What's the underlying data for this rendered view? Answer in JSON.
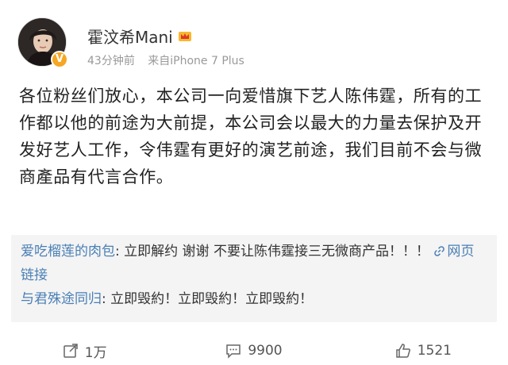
{
  "user": {
    "name": "霍汶希Mani",
    "badge_icon": "crown-icon",
    "time_ago": "43分钟前",
    "source": "来自iPhone 7 Plus",
    "verified_badge": "V"
  },
  "post": {
    "text": "各位粉丝们放心，本公司一向爱惜旗下艺人陈伟霆，所有的工作都以他的前途为大前提，本公司会以最大的力量去保护及开发好艺人工作，令伟霆有更好的演艺前途，我们目前不会与微商產品有代言合作。"
  },
  "comments": [
    {
      "user": "爱吃榴莲的肉包",
      "separator": ": ",
      "text": "立即解约 谢谢 不要让陈伟霆接三无微商产品！！！",
      "link_label": "网页链接"
    },
    {
      "user": "与君殊途同归",
      "separator": ": ",
      "text": "立即毁約！立即毁約！立即毁約！"
    }
  ],
  "actions": {
    "repost": "1万",
    "comment": "9900",
    "like": "1521"
  },
  "colors": {
    "link": "#4a7fb5",
    "meta": "#999999",
    "comment_bg": "#f4f4f4",
    "badge": "#f6a623"
  }
}
